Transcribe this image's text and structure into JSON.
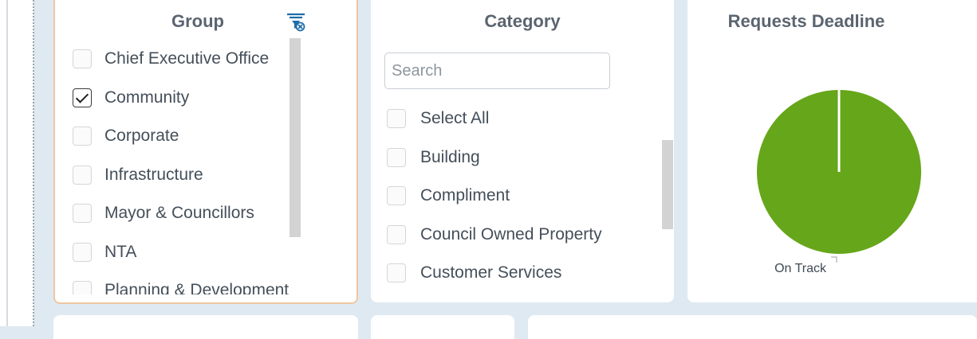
{
  "group_panel": {
    "title": "Group",
    "filter_icon": "filter-clear-icon",
    "items": [
      {
        "label": "Chief Executive Office",
        "checked": false
      },
      {
        "label": "Community",
        "checked": true
      },
      {
        "label": "Corporate",
        "checked": false
      },
      {
        "label": "Infrastructure",
        "checked": false
      },
      {
        "label": "Mayor & Councillors",
        "checked": false
      },
      {
        "label": "NTA",
        "checked": false
      },
      {
        "label": "Planning & Development",
        "checked": false
      }
    ]
  },
  "category_panel": {
    "title": "Category",
    "search": {
      "placeholder": "Search",
      "value": ""
    },
    "select_all": {
      "label": "Select All",
      "checked": false
    },
    "items": [
      {
        "label": "Building",
        "checked": false
      },
      {
        "label": "Compliment",
        "checked": false
      },
      {
        "label": "Council Owned Property",
        "checked": false
      },
      {
        "label": "Customer Services",
        "checked": false
      }
    ]
  },
  "deadline_panel": {
    "title": "Requests Deadline",
    "chart_data": {
      "type": "pie",
      "title": "Requests Deadline",
      "slices": [
        {
          "label": "On Track",
          "value": 100,
          "color": "#66a61a"
        }
      ]
    }
  },
  "colors": {
    "accent_border": "#efc6a2",
    "pie_green": "#66a61a",
    "background": "#dfe9f1"
  }
}
